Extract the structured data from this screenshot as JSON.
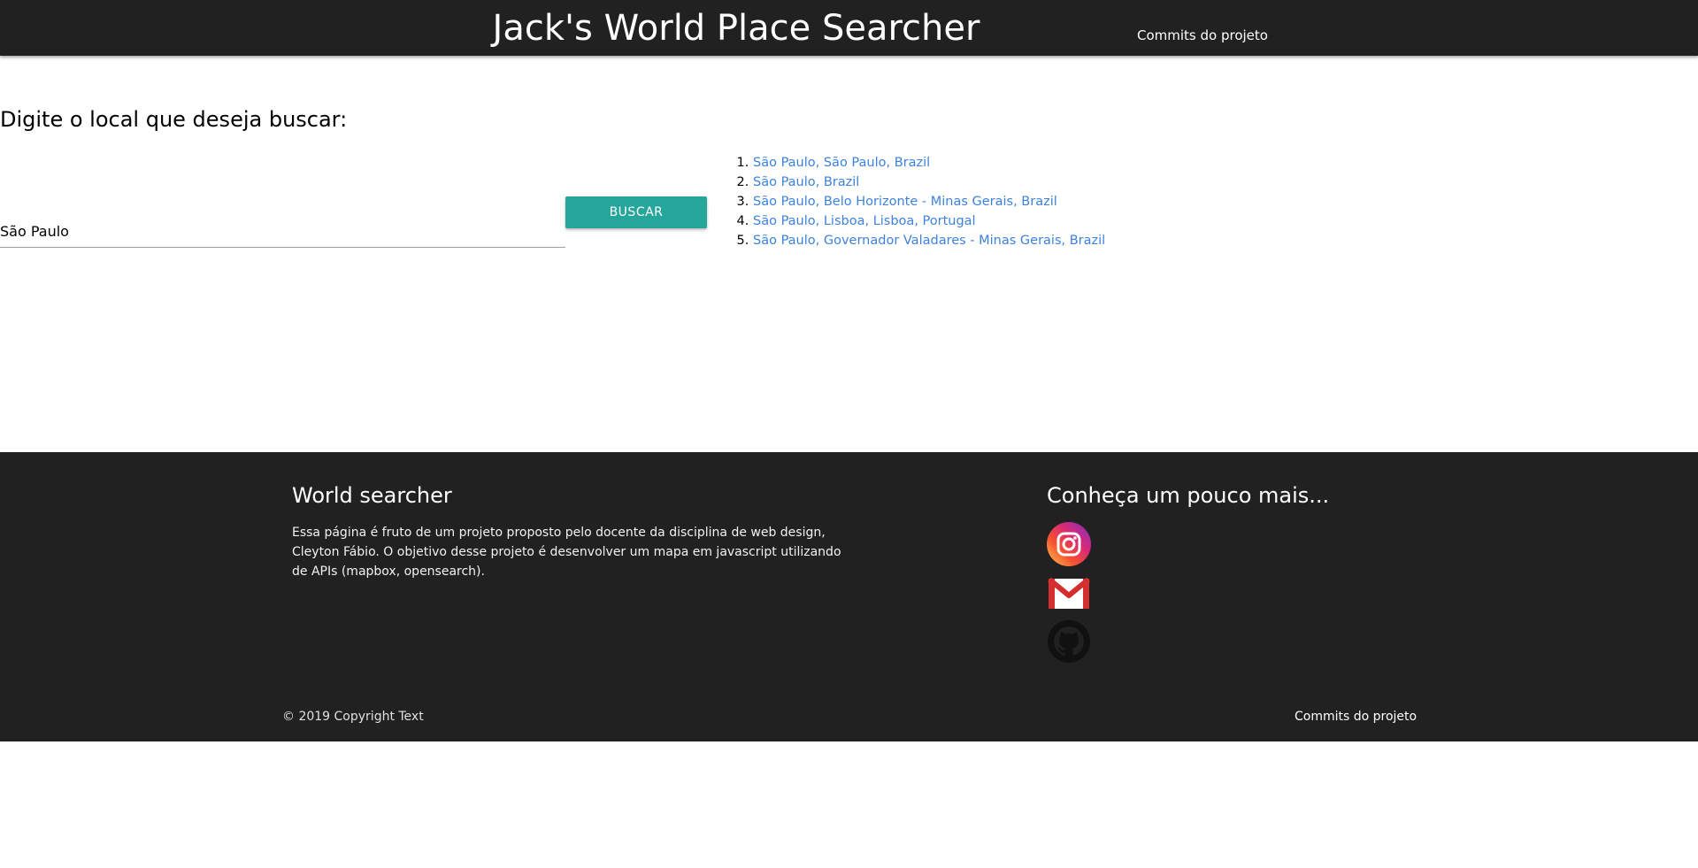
{
  "header": {
    "brand": "Jack's World Place Searcher",
    "nav_link": "Commits do projeto"
  },
  "search": {
    "prompt": "Digite o local que deseja buscar:",
    "value": "São Paulo",
    "button_label": "BUSCAR"
  },
  "results": [
    "São Paulo, São Paulo, Brazil",
    "São Paulo, Brazil",
    "São Paulo, Belo Horizonte - Minas Gerais, Brazil",
    "São Paulo, Lisboa, Lisboa, Portugal",
    "São Paulo, Governador Valadares - Minas Gerais, Brazil"
  ],
  "footer": {
    "title": "World searcher",
    "description": "Essa página é fruto de um projeto proposto pelo docente da disciplina de web design, Cleyton Fábio. O objetivo desse projeto é desenvolver um mapa em javascript utilizando de APIs (mapbox, opensearch).",
    "social_title": "Conheça um pouco mais...",
    "social_icons": [
      "instagram-icon",
      "gmail-icon",
      "github-icon"
    ],
    "copyright": "© 2019 Copyright Text",
    "bottom_link": "Commits do projeto"
  },
  "colors": {
    "nav_background": "#212121",
    "button": "#26a69a",
    "link": "#3d82dd"
  }
}
